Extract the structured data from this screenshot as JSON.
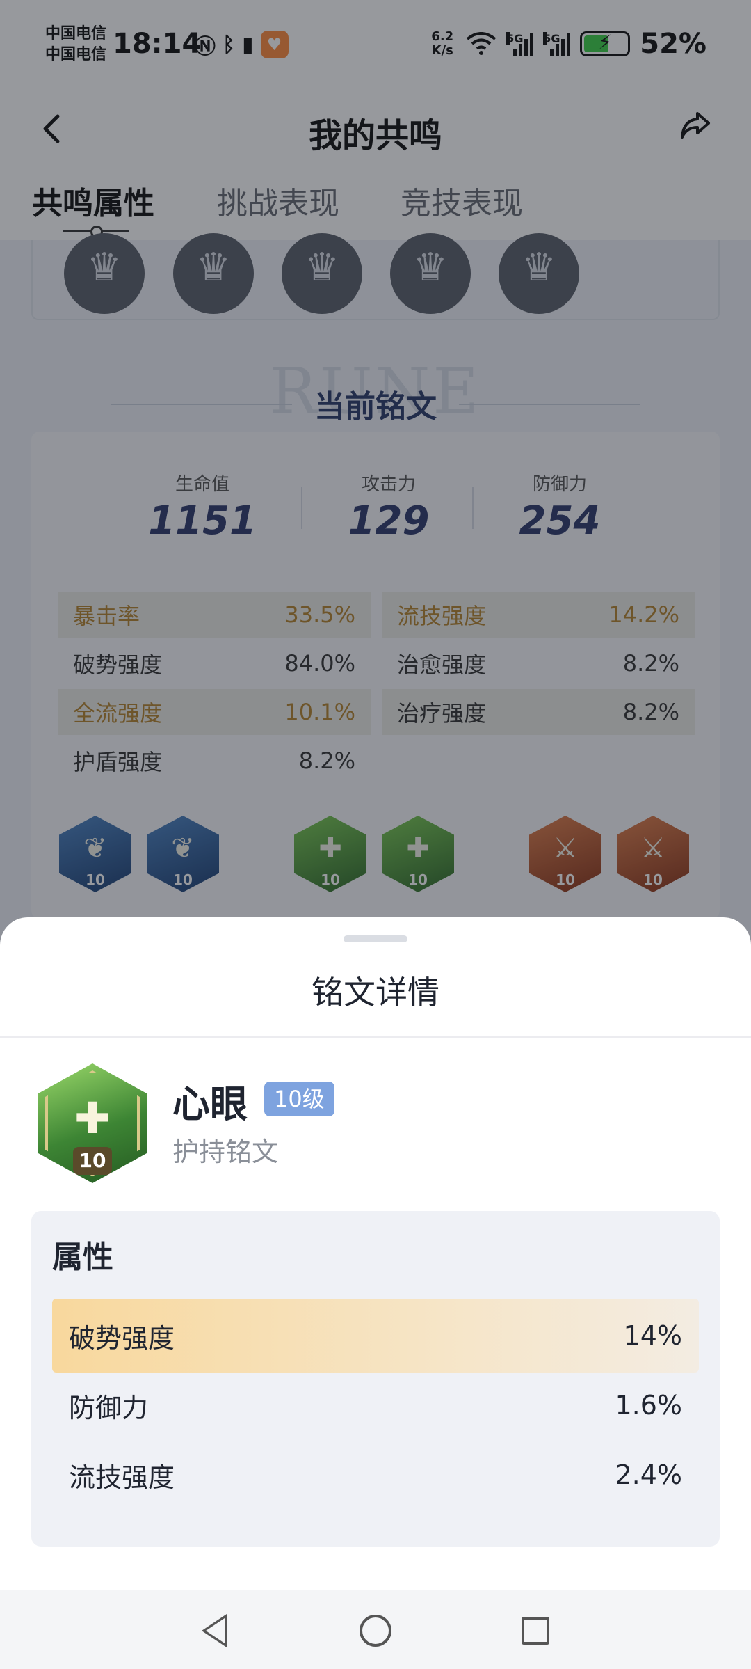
{
  "status_bar": {
    "carrier_1": "中国电信",
    "carrier_2": "中国电信",
    "time": "18:14",
    "net_speed_top": "6.2",
    "net_speed_bottom": "K/s",
    "signal_1_label": "5G",
    "signal_2_label": "5G",
    "battery": "52%",
    "icons": [
      "nfc-icon",
      "bluetooth-icon",
      "vibrate-icon",
      "app-notification-icon",
      "wifi-icon",
      "signal-icon",
      "battery-icon"
    ]
  },
  "nav": {
    "title": "我的共鸣",
    "back_icon": "chevron-left-icon",
    "share_icon": "share-icon"
  },
  "tabs": [
    {
      "label": "共鸣属性",
      "active": true
    },
    {
      "label": "挑战表现",
      "active": false
    },
    {
      "label": "竞技表现",
      "active": false
    }
  ],
  "section": {
    "bg_text": "RUNE",
    "title": "当前铭文"
  },
  "rune_stats": {
    "hp_label": "生命值",
    "hp_value": "1151",
    "atk_label": "攻击力",
    "atk_value": "129",
    "def_label": "防御力",
    "def_value": "254"
  },
  "attributes": [
    {
      "name": "暴击率",
      "value": "33.5%",
      "highlight": true
    },
    {
      "name": "流技强度",
      "value": "14.2%",
      "highlight": true
    },
    {
      "name": "破势强度",
      "value": "84.0%",
      "highlight": false
    },
    {
      "name": "治愈强度",
      "value": "8.2%",
      "highlight": false
    },
    {
      "name": "全流强度",
      "value": "10.1%",
      "highlight": true
    },
    {
      "name": "治疗强度",
      "value": "8.2%",
      "highlight": false
    },
    {
      "name": "护盾强度",
      "value": "8.2%",
      "highlight": false
    }
  ],
  "rune_icons": [
    {
      "color": "blue",
      "level": "10"
    },
    {
      "color": "blue",
      "level": "10"
    },
    {
      "color": "green",
      "level": "10"
    },
    {
      "color": "green",
      "level": "10"
    },
    {
      "color": "red",
      "level": "10"
    },
    {
      "color": "red",
      "level": "10"
    }
  ],
  "sheet": {
    "title": "铭文详情",
    "rune_name": "心眼",
    "rune_level_badge": "10级",
    "rune_type": "护持铭文",
    "rune_icon_level": "10",
    "props_title": "属性",
    "props": [
      {
        "name": "破势强度",
        "value": "14%",
        "highlight": true
      },
      {
        "name": "防御力",
        "value": "1.6%",
        "highlight": false
      },
      {
        "name": "流技强度",
        "value": "2.4%",
        "highlight": false
      }
    ]
  },
  "colors": {
    "accent_gold": "#b4842f",
    "badge_blue": "#7ea3df",
    "stat_navy": "#2f3a6c",
    "highlight_row": "#f8d89d"
  }
}
